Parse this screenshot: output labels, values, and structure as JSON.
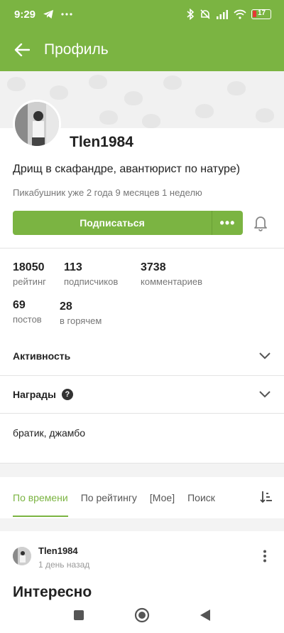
{
  "status_bar": {
    "time": "9:29",
    "battery": "17"
  },
  "header": {
    "title": "Профиль"
  },
  "profile": {
    "username": "Tlen1984",
    "bio": "Дрищ в скафандре, авантюрист по натуре)",
    "since": "Пикабушник уже 2 года 9 месяцев 1 неделю",
    "subscribe_label": "Подписаться",
    "more_label": "•••"
  },
  "stats": [
    {
      "value": "18050",
      "label": "рейтинг"
    },
    {
      "value": "113",
      "label": "подписчиков"
    },
    {
      "value": "3738",
      "label": "комментариев"
    },
    {
      "value": "69",
      "label": "постов"
    },
    {
      "value": "28",
      "label": "в горячем"
    }
  ],
  "sections": {
    "activity": "Активность",
    "awards": "Награды",
    "help": "?",
    "tags": "братик, джамбо"
  },
  "tabs": [
    {
      "label": "По времени",
      "active": true
    },
    {
      "label": "По рейтингу",
      "active": false
    },
    {
      "label": "[Мое]",
      "active": false
    },
    {
      "label": "Поиск",
      "active": false
    }
  ],
  "post": {
    "author": "Tlen1984",
    "time": "1 день назад",
    "title": "Интересно"
  },
  "colors": {
    "accent": "#7bb442",
    "text": "#222222",
    "muted": "#777777"
  }
}
